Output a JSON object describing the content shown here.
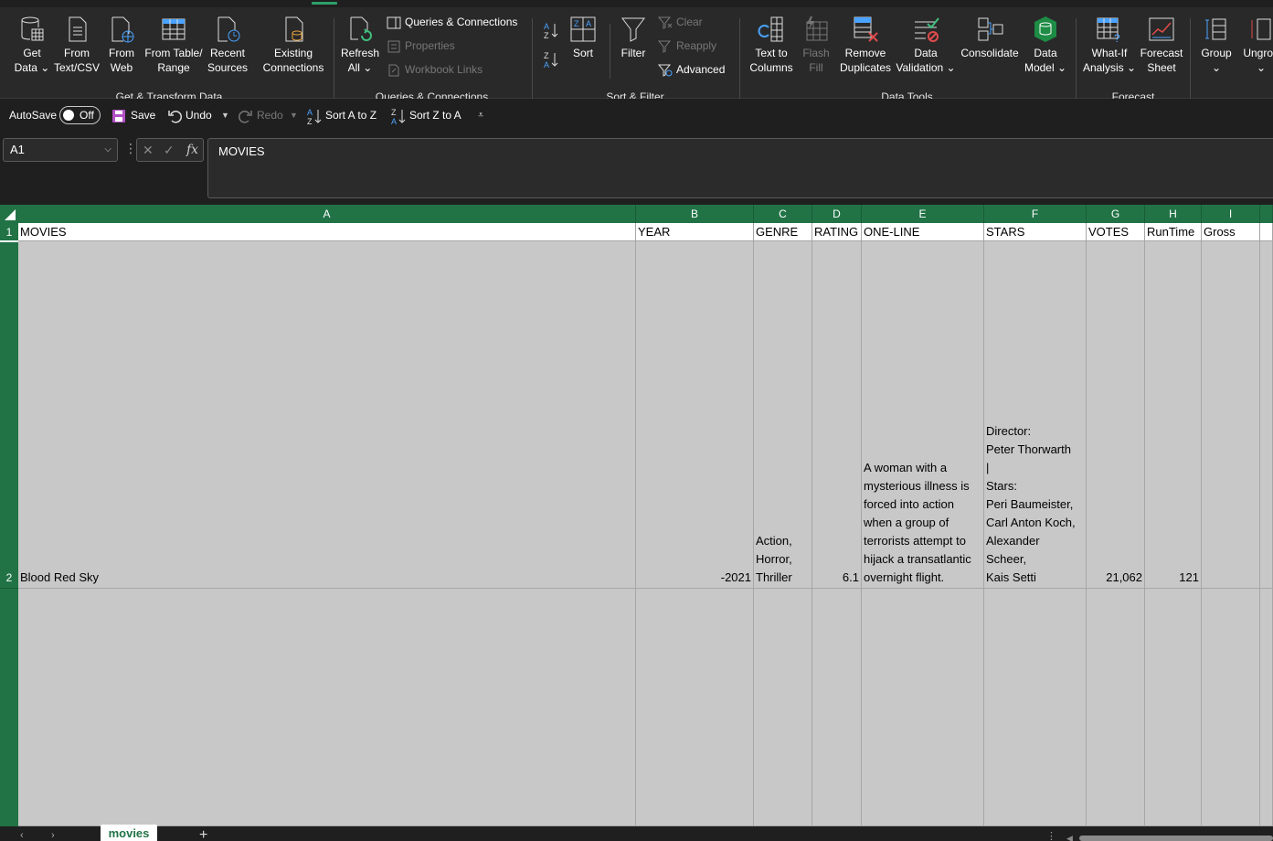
{
  "ribbon": {
    "get_transform": {
      "get_data": "Get\nData ⌄",
      "from_text_csv": "From\nText/CSV",
      "from_web": "From\nWeb",
      "from_table_range": "From Table/\nRange",
      "recent_sources": "Recent\nSources",
      "existing_connections": "Existing\nConnections",
      "group_label": "Get & Transform Data"
    },
    "queries": {
      "refresh_all": "Refresh\nAll ⌄",
      "queries_connections": "Queries & Connections",
      "properties": "Properties",
      "workbook_links": "Workbook Links",
      "group_label": "Queries & Connections"
    },
    "sort_filter": {
      "sort": "Sort",
      "filter": "Filter",
      "clear": "Clear",
      "reapply": "Reapply",
      "advanced": "Advanced",
      "group_label": "Sort & Filter"
    },
    "data_tools": {
      "text_to_columns": "Text to\nColumns",
      "flash_fill": "Flash\nFill",
      "remove_duplicates": "Remove\nDuplicates",
      "data_validation": "Data\nValidation ⌄",
      "consolidate": "Consolidate",
      "data_model": "Data\nModel ⌄",
      "group_label": "Data Tools"
    },
    "forecast": {
      "what_if": "What-If\nAnalysis ⌄",
      "forecast_sheet": "Forecast\nSheet",
      "group_label": "Forecast"
    },
    "outline": {
      "group": "Group\n⌄",
      "ungroup": "Ungrou\n⌄"
    }
  },
  "qat": {
    "autosave": "AutoSave",
    "toggle_state": "Off",
    "save": "Save",
    "undo": "Undo",
    "redo": "Redo",
    "sort_az": "Sort A to Z",
    "sort_za": "Sort Z to A"
  },
  "formula_bar": {
    "name_box": "A1",
    "fx": "fx",
    "content": "MOVIES"
  },
  "columns": [
    "A",
    "B",
    "C",
    "D",
    "E",
    "F",
    "G",
    "H",
    "I"
  ],
  "rows": [
    "1",
    "2"
  ],
  "headers": {
    "a": "MOVIES",
    "b": "YEAR",
    "c": "GENRE",
    "d": "RATING",
    "e": "ONE-LINE",
    "f": "STARS",
    "g": "VOTES",
    "h": "RunTime",
    "i": "Gross"
  },
  "row2": {
    "a": "Blood Red Sky",
    "b": "-2021",
    "c": "Action,\nHorror,\nThriller",
    "d": "6.1",
    "e": "A woman with a\nmysterious illness is\nforced into action\nwhen a group of\nterrorists attempt to\nhijack a transatlantic\novernight flight.",
    "f": "   Director:\nPeter Thorwarth\n|\n   Stars:\nPeri Baumeister,\nCarl Anton Koch,\nAlexander\nScheer,\nKais Setti\n ",
    "g": "21,062",
    "h": "121",
    "i": ""
  },
  "sheet_tabs": {
    "active": "movies",
    "add": "+"
  },
  "colors": {
    "accent": "#217346",
    "ribbon_bg": "#292929",
    "app_bg": "#1f1f1f"
  }
}
